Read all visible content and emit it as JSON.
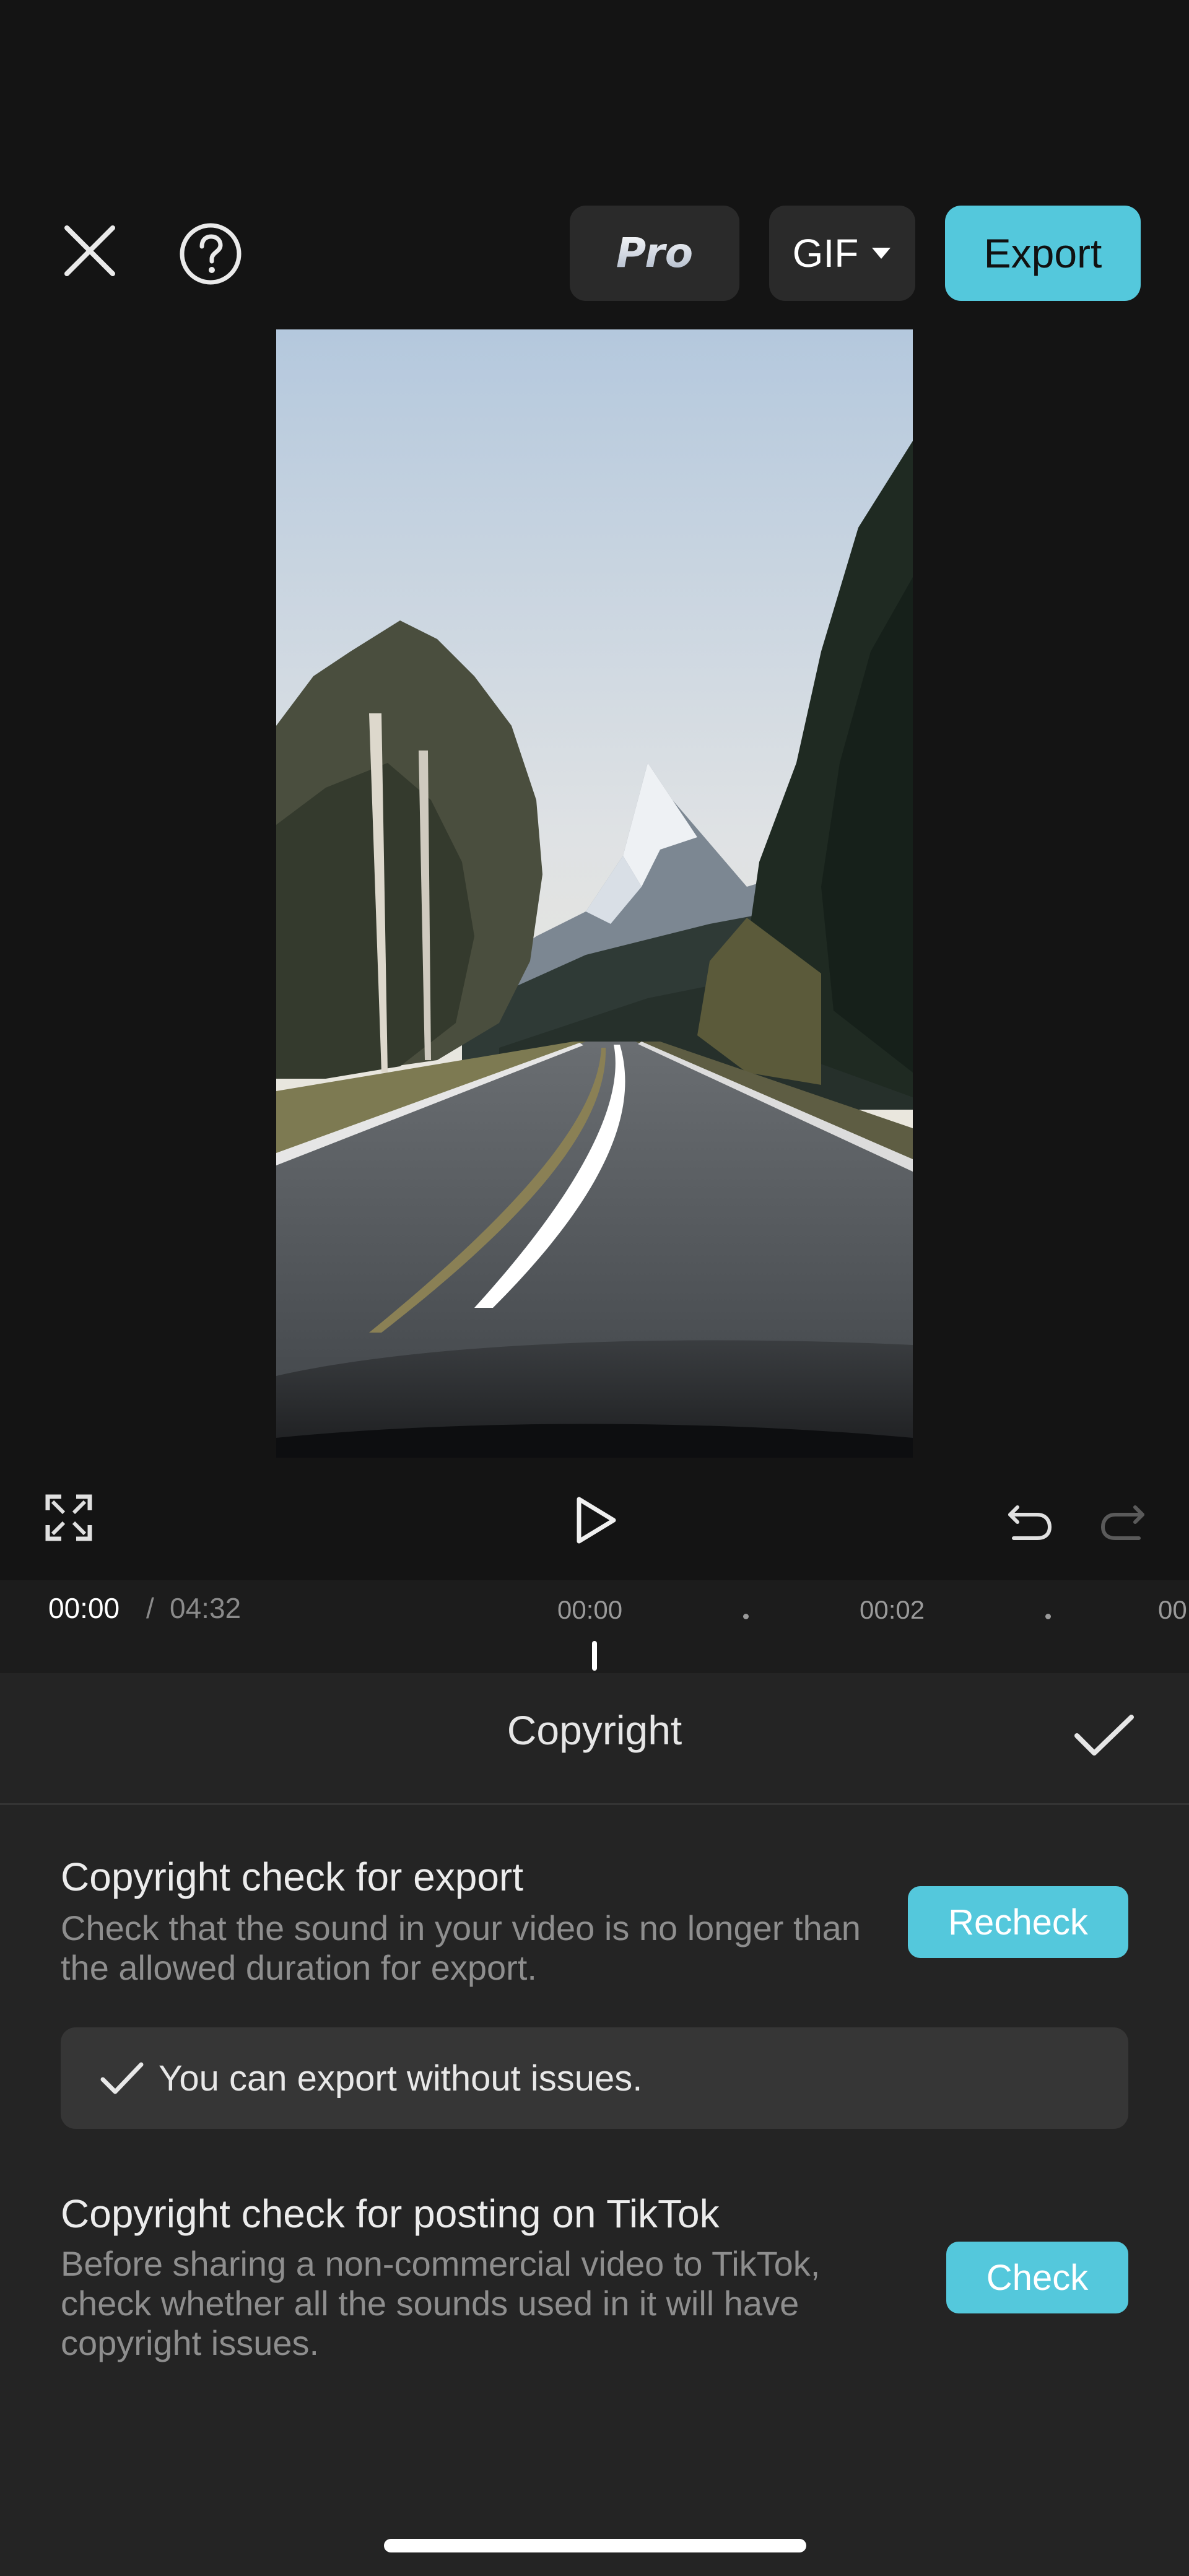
{
  "toolbar": {
    "pro_label": "Pro",
    "format_label": "GIF",
    "export_label": "Export"
  },
  "playback": {
    "current_time": "00:00",
    "separator": "/",
    "total_time": "04:32"
  },
  "timeline": {
    "ticks": [
      "00:00",
      "00:02",
      "00"
    ]
  },
  "copyright_panel": {
    "title": "Copyright",
    "export_check": {
      "title": "Copyright check for export",
      "description": "Check that the sound in your video is no longer than the allowed duration for export.",
      "button_label": "Recheck",
      "status": "You can export without issues."
    },
    "tiktok_check": {
      "title": "Copyright check for posting on TikTok",
      "description": "Before sharing a non-commercial video to TikTok, check whether all the sounds used in it will have copyright issues.",
      "button_label": "Check"
    }
  },
  "colors": {
    "accent": "#54c8dc",
    "background": "#141414",
    "panel": "#242424"
  }
}
